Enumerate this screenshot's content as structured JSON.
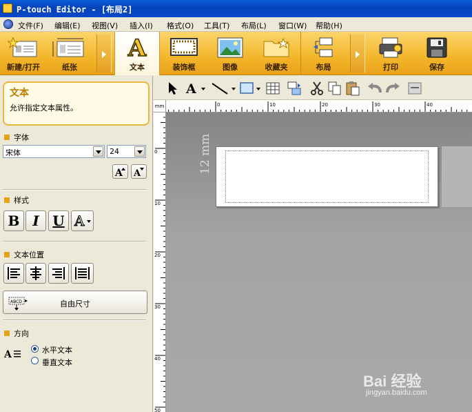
{
  "window": {
    "title": "P-touch Editor - [布局2]"
  },
  "menu": [
    "文件(F)",
    "编辑(E)",
    "视图(V)",
    "插入(I)",
    "格式(O)",
    "工具(T)",
    "布局(L)",
    "窗口(W)",
    "帮助(H)"
  ],
  "ribbon": {
    "new_open": "新建/打开",
    "paper": "纸张",
    "text": "文本",
    "frame": "装饰框",
    "image": "图像",
    "clipart": "收藏夹",
    "layout": "布局",
    "print": "打印",
    "save": "保存"
  },
  "panel": {
    "title": "文本",
    "description": "允许指定文本属性。",
    "font_section": "字体",
    "font_name": "宋体",
    "font_size": "24",
    "style_section": "样式",
    "bold": "B",
    "italic": "I",
    "underline": "U",
    "outline": "A",
    "position_section": "文本位置",
    "free_size": "自由尺寸",
    "direction_section": "方向",
    "horizontal": "水平文本",
    "vertical": "垂直文本"
  },
  "canvas": {
    "tape_size": "12 mm",
    "ruler_unit": "mm"
  },
  "ruler": {
    "h_ticks": [
      "0",
      "10",
      "20",
      "30",
      "40"
    ],
    "v_ticks": [
      "0",
      "10",
      "20",
      "30",
      "40",
      "50"
    ]
  },
  "watermark": {
    "brand": "Bai 经验",
    "url": "jingyan.baidu.com"
  }
}
